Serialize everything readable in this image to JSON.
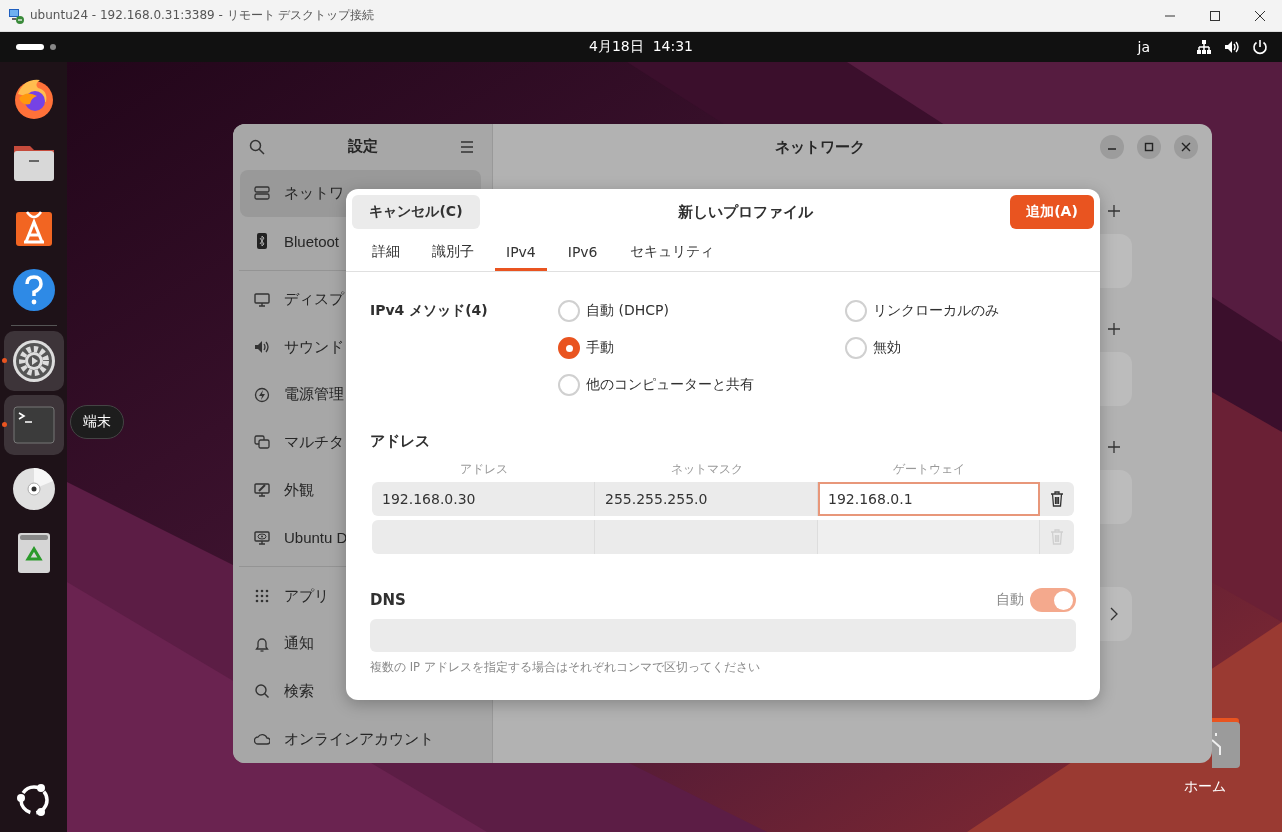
{
  "remote_window": {
    "title": "ubuntu24 - 192.168.0.31:3389 - リモート デスクトップ接続"
  },
  "top_bar": {
    "clock": "4月18日  14:31",
    "input_method": "ja"
  },
  "dock": {
    "groups": [
      {
        "items": [
          {
            "running": false,
            "highlighted": false
          },
          {
            "running": false,
            "highlighted": false
          },
          {
            "running": false,
            "highlighted": false
          },
          {
            "running": false,
            "highlighted": false
          }
        ]
      },
      {
        "items": [
          {
            "running": true,
            "highlighted": true
          },
          {
            "running": true,
            "highlighted": true
          },
          {
            "running": false,
            "highlighted": false
          },
          {
            "running": false,
            "highlighted": false
          }
        ]
      }
    ],
    "tooltip": "端末"
  },
  "desktop": {
    "home_label": "ホーム"
  },
  "settings": {
    "title": "設定",
    "page_title": "ネットワーク",
    "sidebar_groups": [
      {
        "items": [
          {
            "label": "ネットワ",
            "selected": true
          },
          {
            "label": "Bluetoot",
            "selected": false
          }
        ]
      },
      {
        "items": [
          {
            "label": "ディスプ",
            "selected": false
          },
          {
            "label": "サウンド",
            "selected": false
          },
          {
            "label": "電源管理",
            "selected": false
          },
          {
            "label": "マルチタ",
            "selected": false
          },
          {
            "label": "外観",
            "selected": false
          },
          {
            "label": "Ubuntu D",
            "selected": false
          }
        ]
      },
      {
        "items": [
          {
            "label": "アプリ",
            "selected": false
          },
          {
            "label": "通知",
            "selected": false
          },
          {
            "label": "検索",
            "selected": false
          },
          {
            "label": "オンラインアカウント",
            "selected": false
          }
        ]
      }
    ]
  },
  "dialog": {
    "cancel": "キャンセル(C)",
    "title": "新しいプロファイル",
    "add": "追加(A)",
    "tabs": [
      {
        "label": "詳細",
        "selected": false
      },
      {
        "label": "識別子",
        "selected": false
      },
      {
        "label": "IPv4",
        "selected": true
      },
      {
        "label": "IPv6",
        "selected": false
      },
      {
        "label": "セキュリティ",
        "selected": false
      }
    ],
    "method_label": "IPv4 メソッド(4)",
    "methods": [
      {
        "label": "自動 (DHCP)",
        "selected": false
      },
      {
        "label": "リンクローカルのみ",
        "selected": false
      },
      {
        "label": "手動",
        "selected": true
      },
      {
        "label": "無効",
        "selected": false
      },
      {
        "label": "他のコンピューターと共有",
        "selected": false
      }
    ],
    "address_heading": "アドレス",
    "address_columns": [
      "アドレス",
      "ネットマスク",
      "ゲートウェイ"
    ],
    "address_rows": [
      {
        "cells": [
          {
            "value": "192.168.0.30",
            "focused": false
          },
          {
            "value": "255.255.255.0",
            "focused": false
          },
          {
            "value": "192.168.0.1",
            "focused": true
          }
        ]
      }
    ],
    "blank_row": true,
    "dns": {
      "heading": "DNS",
      "auto_label": "自動",
      "auto": true,
      "hint": "複数の IP アドレスを指定する場合はそれぞれコンマで区切ってください"
    }
  }
}
